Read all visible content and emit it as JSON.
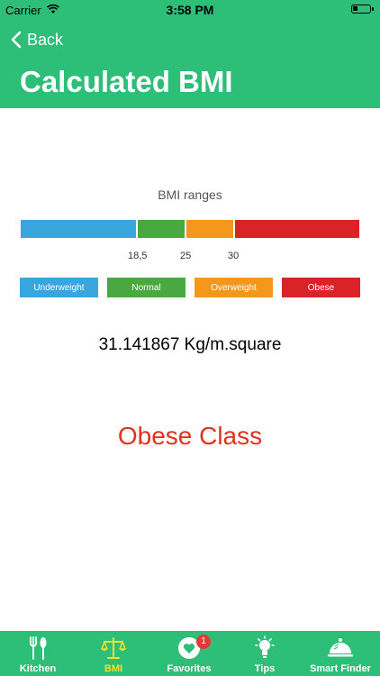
{
  "status_bar": {
    "carrier": "Carrier",
    "time": "3:58 PM"
  },
  "nav": {
    "back_label": "Back",
    "title": "Calculated BMI"
  },
  "ranges": {
    "title": "BMI ranges",
    "ticks": [
      "18,5",
      "25",
      "30"
    ],
    "legend": [
      {
        "label": "Underweight",
        "color": "#3aa6e0"
      },
      {
        "label": "Normal",
        "color": "#4aa840"
      },
      {
        "label": "Overweight",
        "color": "#f3981c"
      },
      {
        "label": "Obese",
        "color": "#d92329"
      }
    ]
  },
  "result": {
    "value": "31.141867 Kg/m.square",
    "class_label": "Obese Class"
  },
  "tabs": [
    {
      "label": "Kitchen",
      "icon": "fork-spoon-icon"
    },
    {
      "label": "BMI",
      "icon": "scale-icon",
      "active": true
    },
    {
      "label": "Favorites",
      "icon": "heart-icon",
      "badge": "1"
    },
    {
      "label": "Tips",
      "icon": "lightbulb-icon"
    },
    {
      "label": "Smart Finder",
      "icon": "cloche-icon"
    }
  ]
}
